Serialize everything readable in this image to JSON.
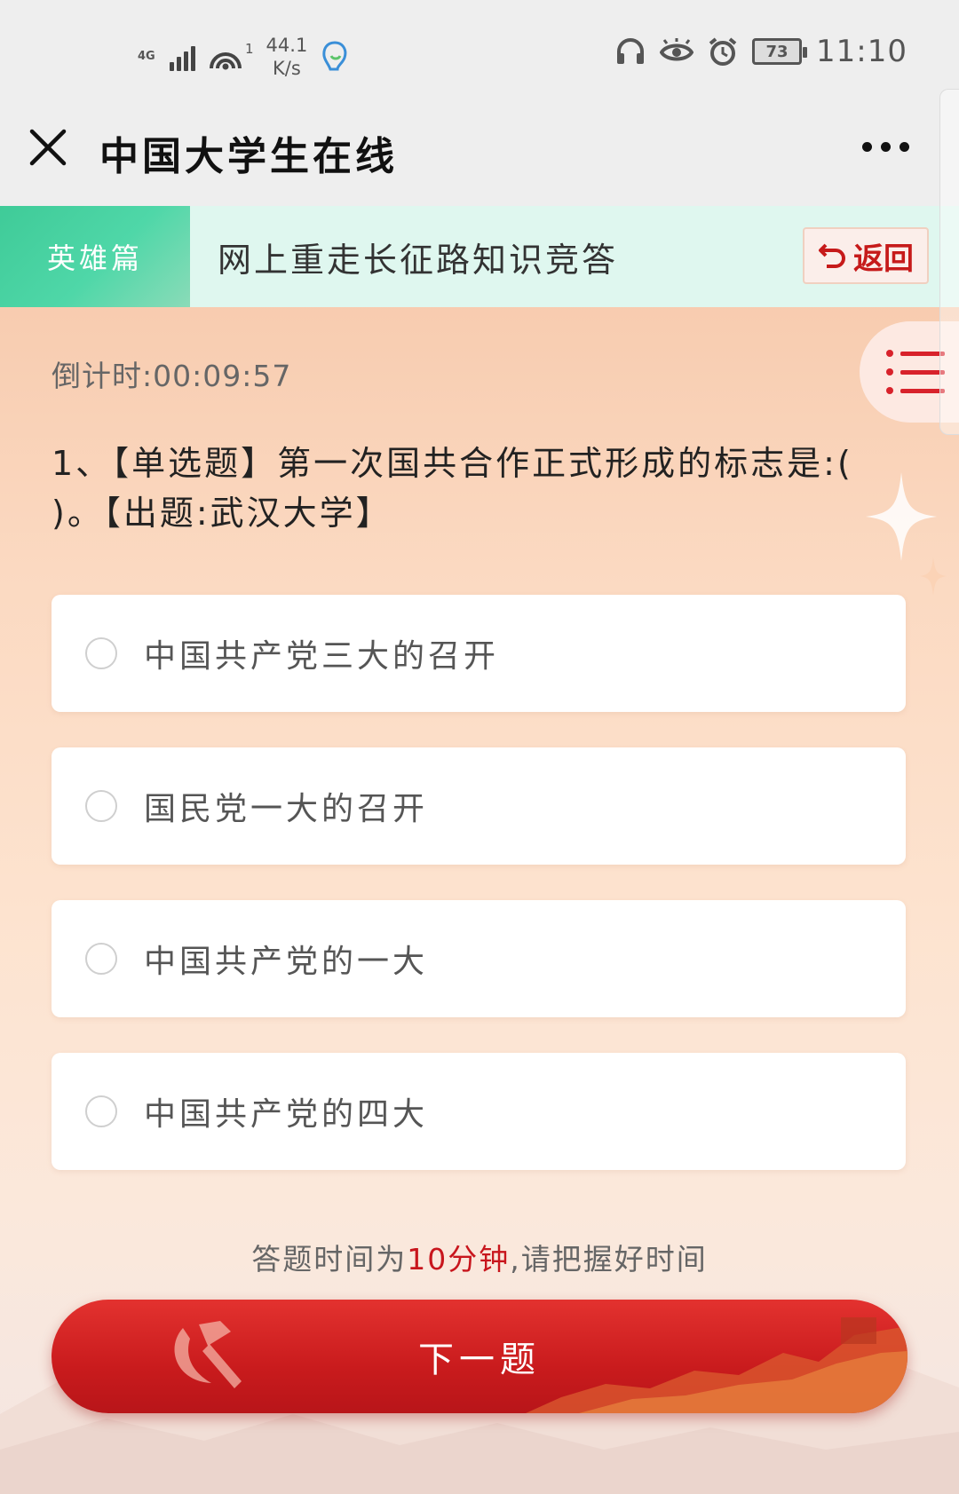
{
  "status_bar": {
    "network": "4G",
    "hotspot_count": "1",
    "speed_value": "44.1",
    "speed_unit": "K/s",
    "battery": "73",
    "time": "11:10"
  },
  "app_bar": {
    "title": "中国大学生在线"
  },
  "banner": {
    "tag": "英雄篇",
    "title": "网上重走长征路知识竞答",
    "back_label": "返回"
  },
  "quiz": {
    "timer_label": "倒计时:",
    "timer_value": "00:09:57",
    "question": "1、【单选题】第一次国共合作正式形成的标志是:( )。【出题:武汉大学】",
    "options": [
      "中国共产党三大的召开",
      "国民党一大的召开",
      "中国共产党的一大",
      "中国共产党的四大"
    ]
  },
  "footer": {
    "hint_prefix": "答题时间为",
    "hint_highlight": "10分钟",
    "hint_suffix": ",请把握好时间",
    "next_label": "下一题"
  },
  "colors": {
    "accent_red": "#c8161d",
    "banner_green": "#4fd7a8",
    "banner_bg": "#dff7ef"
  }
}
